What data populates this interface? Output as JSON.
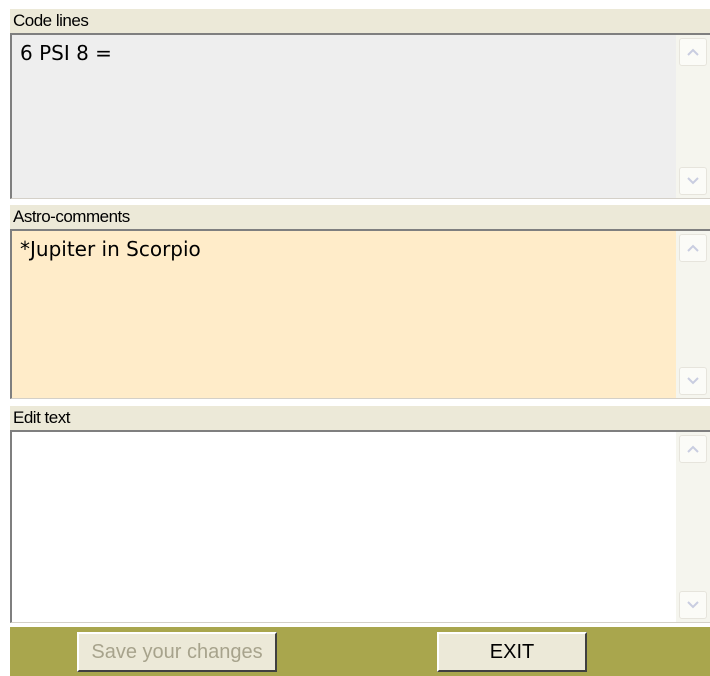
{
  "sections": {
    "code_lines": {
      "label": "Code lines",
      "value": "6 PSI 8 =",
      "background": "#eeeeee"
    },
    "astro_comments": {
      "label": "Astro-comments",
      "value": "*Jupiter in Scorpio",
      "background": "#ffecc9"
    },
    "edit_text": {
      "label": "Edit text",
      "value": "",
      "background": "#ffffff"
    }
  },
  "buttons": {
    "save_label": "Save your changes",
    "save_enabled": false,
    "exit_label": "EXIT"
  },
  "colors": {
    "button_bar": "#a9a64d",
    "label_bg": "#ece9d8"
  },
  "icons": {
    "scroll_up": "chevron-up-icon",
    "scroll_down": "chevron-down-icon"
  }
}
